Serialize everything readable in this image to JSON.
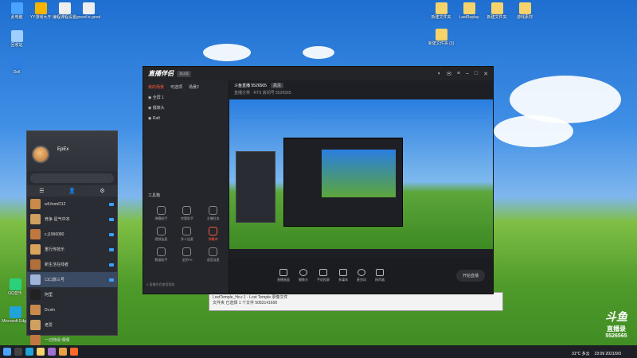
{
  "colors": {
    "accent": "#ff5a3c",
    "blue": "#3aa0ff"
  },
  "desktop": {
    "icons": [
      {
        "label": "此电脑",
        "x": 0
      },
      {
        "label": "YY游戏大厅",
        "x": 1
      },
      {
        "label": "编程课程设置",
        "x": 2
      },
      {
        "label": "greed is good",
        "x": 3
      },
      {
        "label": "回收站",
        "x": 4
      },
      {
        "label": "Dell",
        "x": 5
      }
    ],
    "icons_right": [
      "新建文件夹",
      "LastReplay",
      "新建文件夹",
      "游戏素材",
      "新建文件夹 (3)",
      "新建文件夹 (4)"
    ],
    "bottom_left": [
      "Microsoft Edge",
      "QQ音乐"
    ]
  },
  "buddy": {
    "name": "EpEx",
    "tabs": [
      "☰",
      "👤",
      "⚙"
    ],
    "rows": [
      "wll.fromD12",
      "竞争·星气中本",
      "c.j1996080",
      "重行传技乐",
      "新生活在线者",
      "口口旅三号",
      "阿里",
      "Dr.eln",
      "老爱",
      "一切随缘 哪哪"
    ]
  },
  "live": {
    "logo": "直播伴侣",
    "version": "测试版",
    "left_tabs": [
      "我的场景",
      "可选项",
      "场景2"
    ],
    "scenes": [
      "全屏 1",
      "摄像头",
      "Raft"
    ],
    "tools_title": "工具箱",
    "tools": [
      "弹幕助手",
      "房管助手",
      "主播任务",
      "视频连麦",
      "多人连麦",
      "弹幕库",
      "数据助手",
      "全民PK",
      "语音连麦",
      "PK",
      "直播工具",
      "更多"
    ],
    "footer": "3.直播伴侣使用帮助",
    "title": "斗鱼直播 5526565",
    "tag": "高清",
    "sub": "直播分类 · RTS    房间号 5526565",
    "controls": [
      "直播画面",
      "摄像头",
      "手机投屏",
      "多媒体",
      "麦克风",
      "扬声器"
    ],
    "start": "开始直播"
  },
  "explorer": {
    "line1": "LostTemple_Ho.r.1 - Lost Temple 录像文件",
    "line2": "文件夹   已选择 1 个文件   5083141600"
  },
  "taskbar": {
    "weather": "31°C 多云",
    "time": "23:09",
    "date": "2021/9/3"
  },
  "watermark": {
    "brand": "斗鱼",
    "name": "直播录",
    "room": "5526565"
  }
}
